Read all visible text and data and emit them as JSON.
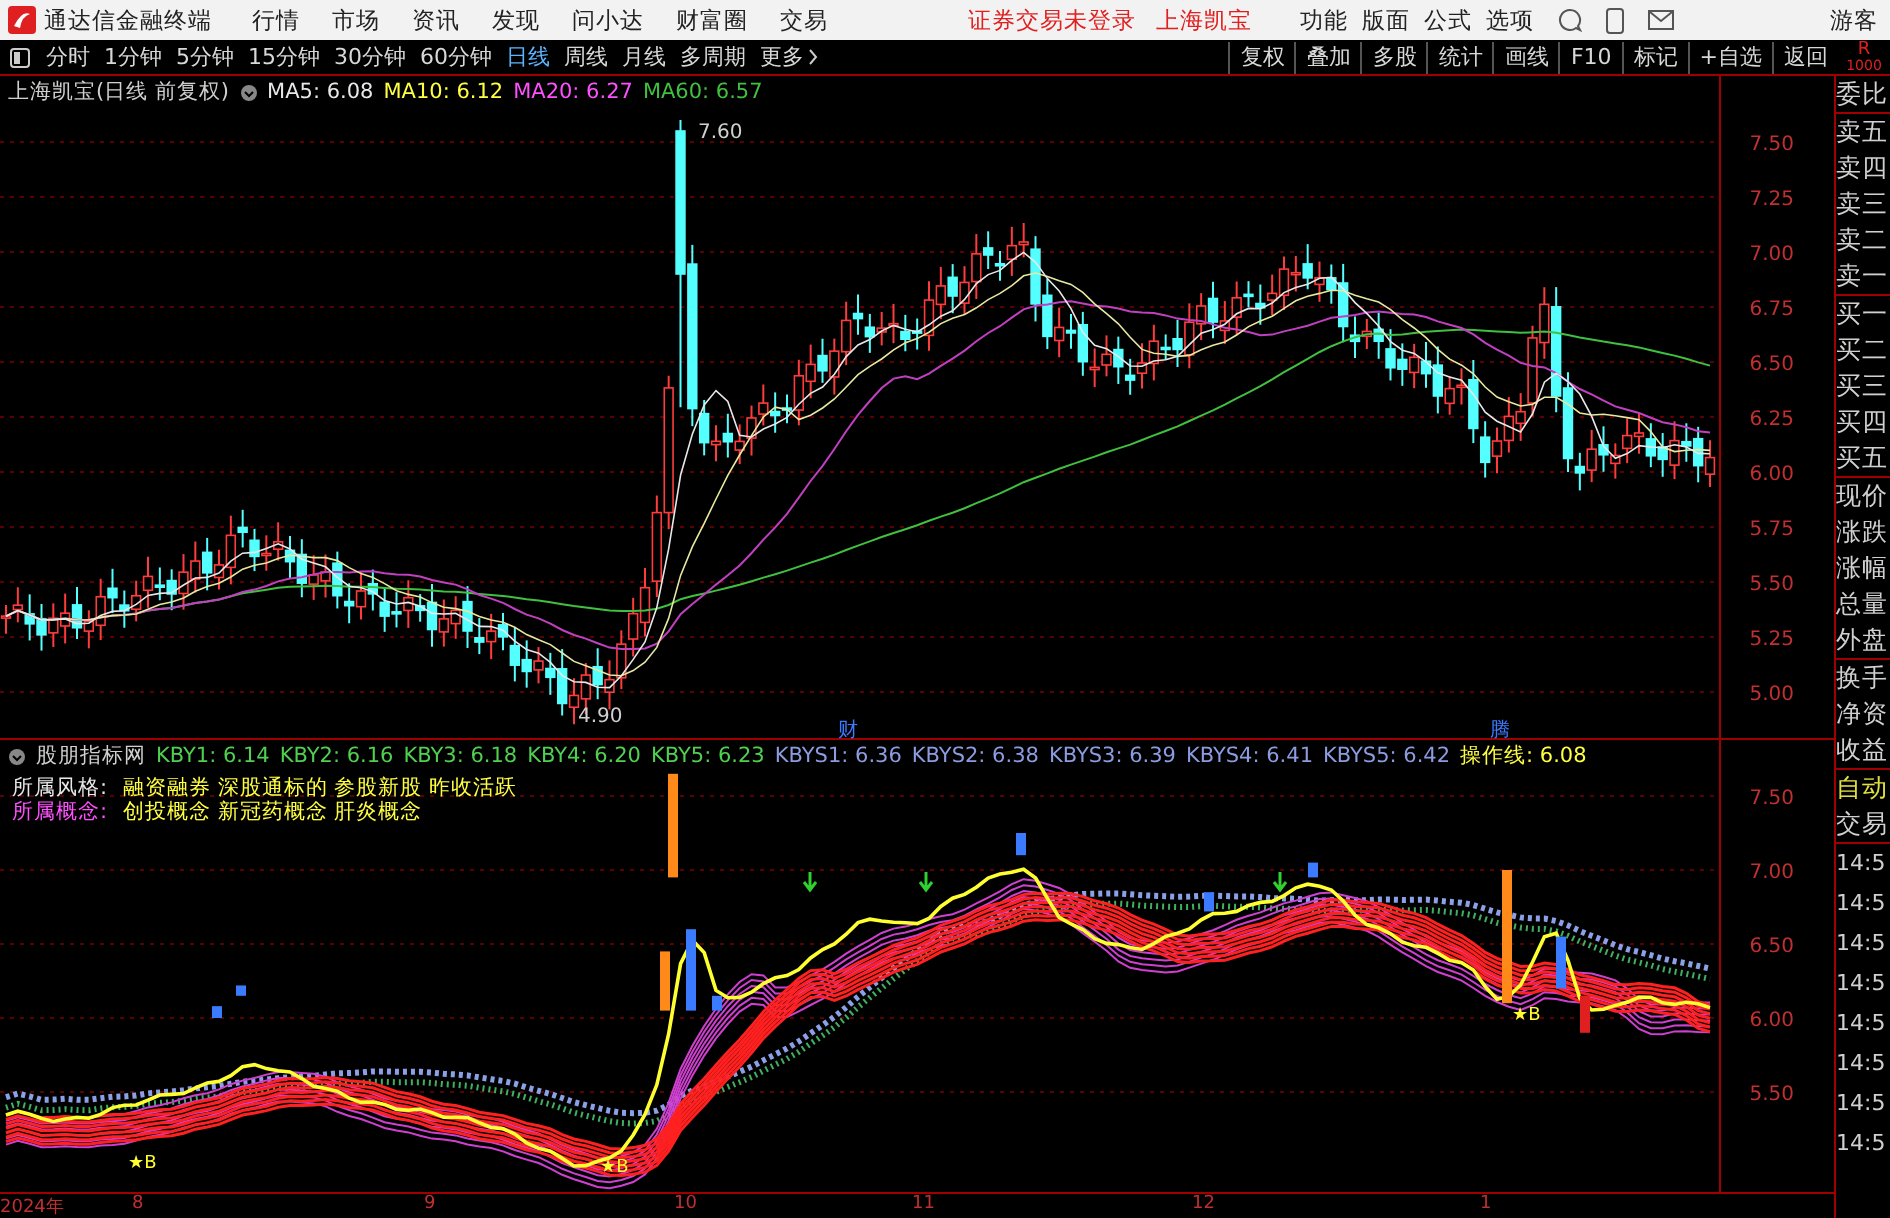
{
  "menu_bar": {
    "app_title": "通达信金融终端",
    "menus": [
      "行情",
      "市场",
      "资讯",
      "发现",
      "问小达",
      "财富圈",
      "交易"
    ],
    "notices": [
      "证券交易未登录",
      "上海凯宝"
    ],
    "tools": [
      "功能",
      "版面",
      "公式",
      "选项"
    ],
    "user": "游客"
  },
  "toolbar": {
    "periods": [
      {
        "label": "分时",
        "selected": false
      },
      {
        "label": "1分钟",
        "selected": false
      },
      {
        "label": "5分钟",
        "selected": false
      },
      {
        "label": "15分钟",
        "selected": false
      },
      {
        "label": "30分钟",
        "selected": false
      },
      {
        "label": "60分钟",
        "selected": false
      },
      {
        "label": "日线",
        "selected": true
      },
      {
        "label": "周线",
        "selected": false
      },
      {
        "label": "月线",
        "selected": false
      },
      {
        "label": "多周期",
        "selected": false
      }
    ],
    "more": "更多",
    "actions": [
      "复权",
      "叠加",
      "多股",
      "统计",
      "画线",
      "F10",
      "标记",
      "+自选",
      "返回"
    ],
    "corner_badge": [
      "R",
      "1000"
    ]
  },
  "main_chart": {
    "title": "上海凯宝(日线 前复权)",
    "moving_averages": [
      {
        "text": "MA5: 6.08",
        "color": "#e8e8e8"
      },
      {
        "text": "MA10: 6.12",
        "color": "#ffff40"
      },
      {
        "text": "MA20: 6.27",
        "color": "#ff50ff"
      },
      {
        "text": "MA60: 6.57",
        "color": "#40c040"
      }
    ],
    "yticks": [
      "7.50",
      "7.25",
      "7.00",
      "6.75",
      "6.50",
      "6.25",
      "6.00",
      "5.75",
      "5.50",
      "5.25",
      "5.00"
    ],
    "high_label": "7.60",
    "low_label": "4.90",
    "event_marks": [
      "财",
      "腾"
    ]
  },
  "indicator": {
    "title": "股朋指标网",
    "values": [
      {
        "text": "KBY1: 6.14",
        "color": "#50d050"
      },
      {
        "text": "KBY2: 6.16",
        "color": "#50d050"
      },
      {
        "text": "KBY3: 6.18",
        "color": "#50d050"
      },
      {
        "text": "KBY4: 6.20",
        "color": "#50d050"
      },
      {
        "text": "KBY5: 6.23",
        "color": "#50d050"
      },
      {
        "text": "KBYS1: 6.36",
        "color": "#8c9ce0"
      },
      {
        "text": "KBYS2: 6.38",
        "color": "#8c9ce0"
      },
      {
        "text": "KBYS3: 6.39",
        "color": "#8c9ce0"
      },
      {
        "text": "KBYS4: 6.41",
        "color": "#8c9ce0"
      },
      {
        "text": "KBYS5: 6.42",
        "color": "#8c9ce0"
      },
      {
        "text": "操作线: 6.08",
        "color": "#ffff40"
      }
    ],
    "tags": [
      {
        "label": "所属风格:",
        "value": "融资融券 深股通标的 参股新股 昨收活跃",
        "color": "#e8e8e8"
      },
      {
        "label": "所属概念:",
        "value": "创投概念 新冠药概念 肝炎概念",
        "color": "#ff50ff"
      }
    ],
    "yticks": [
      "7.50",
      "7.00",
      "6.50",
      "6.00",
      "5.50"
    ],
    "signals": [
      "★B",
      "★B",
      "★B"
    ]
  },
  "time_axis": [
    "2024年",
    "8",
    "9",
    "10",
    "11",
    "12",
    "1"
  ],
  "side_panel": {
    "quote_groups": [
      [
        "委比"
      ],
      [
        "卖五",
        "卖四",
        "卖三",
        "卖二",
        "卖一"
      ],
      [
        "买一",
        "买二",
        "买三",
        "买四",
        "买五"
      ],
      [
        "现价",
        "涨跌",
        "涨幅",
        "总量",
        "外盘"
      ],
      [
        "换手",
        "净资",
        "收益"
      ]
    ],
    "trade_label": [
      "自动",
      "交易"
    ],
    "times": [
      "14:5",
      "14:5",
      "14:5",
      "14:5",
      "14:5",
      "14:5",
      "14:5",
      "14:5"
    ]
  }
}
